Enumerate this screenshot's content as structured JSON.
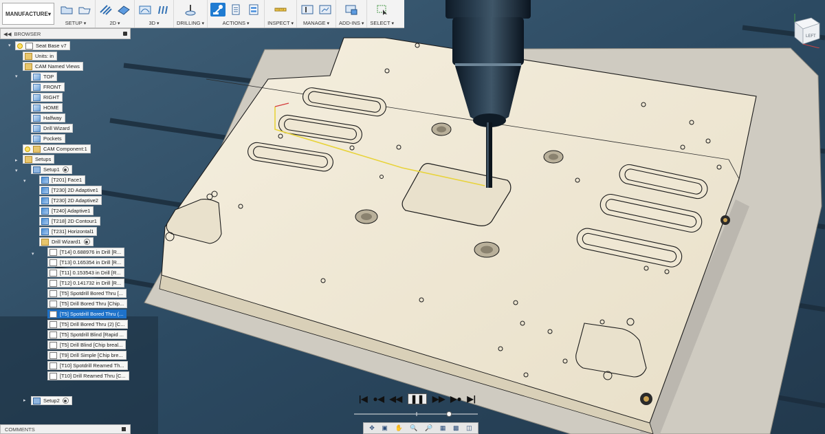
{
  "toolbar": {
    "workspace": "MANUFACTURE",
    "groups": [
      {
        "label": "SETUP"
      },
      {
        "label": "2D"
      },
      {
        "label": "3D"
      },
      {
        "label": "DRILLING"
      },
      {
        "label": "ACTIONS"
      },
      {
        "label": "INSPECT"
      },
      {
        "label": "MANAGE"
      },
      {
        "label": "ADD-INS"
      },
      {
        "label": "SELECT"
      }
    ]
  },
  "browser": {
    "title": "BROWSER",
    "items": [
      {
        "label": "Seat Base v7"
      },
      {
        "label": "Units: in"
      },
      {
        "label": "CAM Named Views"
      },
      {
        "label": "TOP"
      },
      {
        "label": "FRONT"
      },
      {
        "label": "RIGHT"
      },
      {
        "label": "HOME"
      },
      {
        "label": "Halfway"
      },
      {
        "label": "Drill Wizard"
      },
      {
        "label": "Pockets"
      },
      {
        "label": "CAM Component:1"
      },
      {
        "label": "Setups"
      },
      {
        "label": "Setup1"
      },
      {
        "label": "[T201] Face1"
      },
      {
        "label": "[T230] 2D Adaptive1"
      },
      {
        "label": "[T230] 2D Adaptive2"
      },
      {
        "label": "[T240] Adaptive1"
      },
      {
        "label": "[T218] 2D Contour1"
      },
      {
        "label": "[T231] Horizontal1"
      },
      {
        "label": "Drill Wizard1"
      },
      {
        "label": "[T14] 0.688976 in Drill [R..."
      },
      {
        "label": "[T13] 0.165354 in Drill [R..."
      },
      {
        "label": "[T11] 0.153543 in Drill [R..."
      },
      {
        "label": "[T12] 0.141732 in Drill [R..."
      },
      {
        "label": "[T5] Spotdrill Bored Thru [..."
      },
      {
        "label": "[T5] Drill Bored Thru [Chip..."
      },
      {
        "label": "[T5] Spotdrill Bored Thru (..."
      },
      {
        "label": "[T5] Drill Bored Thru (2) [C..."
      },
      {
        "label": "[T5] Spotdrill Blind [Rapid ..."
      },
      {
        "label": "[T5] Drill Blind [Chip breal..."
      },
      {
        "label": "[T9] Drill Simple [Chip bre..."
      },
      {
        "label": "[T10] Spotdrill Reamed Th..."
      },
      {
        "label": "[T10] Drill Reamed Thru [C..."
      },
      {
        "label": "Setup2"
      }
    ]
  },
  "comments": {
    "title": "COMMENTS"
  },
  "viewcube": {
    "face": "LEFT"
  },
  "playback": {
    "buttons": [
      "go-to-start",
      "previous-operation",
      "step-back",
      "play-pause",
      "step-forward",
      "next-operation",
      "go-to-end"
    ],
    "progress": 0.78
  },
  "colors": {
    "accent": "#1e72c9",
    "plate": "#efe8d6",
    "machine_table": "#2e4a60",
    "toolpath": "#e8d33a"
  }
}
